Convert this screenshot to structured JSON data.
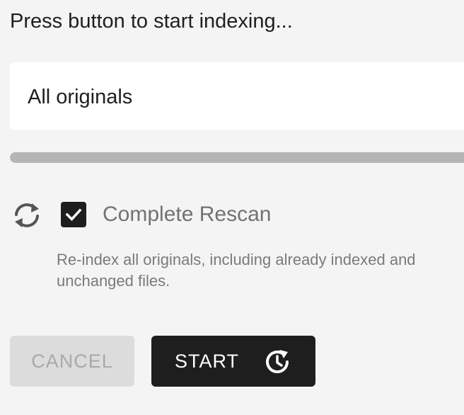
{
  "status": {
    "text": "Press button to start indexing..."
  },
  "path_select": {
    "selected": "All originals"
  },
  "progress": {
    "fraction": 0
  },
  "rescan": {
    "icon": "sync-icon",
    "checked": true,
    "label": "Complete Rescan",
    "hint": "Re-index all originals, including already indexed and unchanged files."
  },
  "actions": {
    "cancel_label": "CANCEL",
    "start_label": "START",
    "start_icon": "history-icon"
  },
  "colors": {
    "background": "#f4f4f4",
    "primary": "#1e1e1e",
    "disabled_button": "#dcdcdc",
    "track": "#b5b5b5"
  }
}
